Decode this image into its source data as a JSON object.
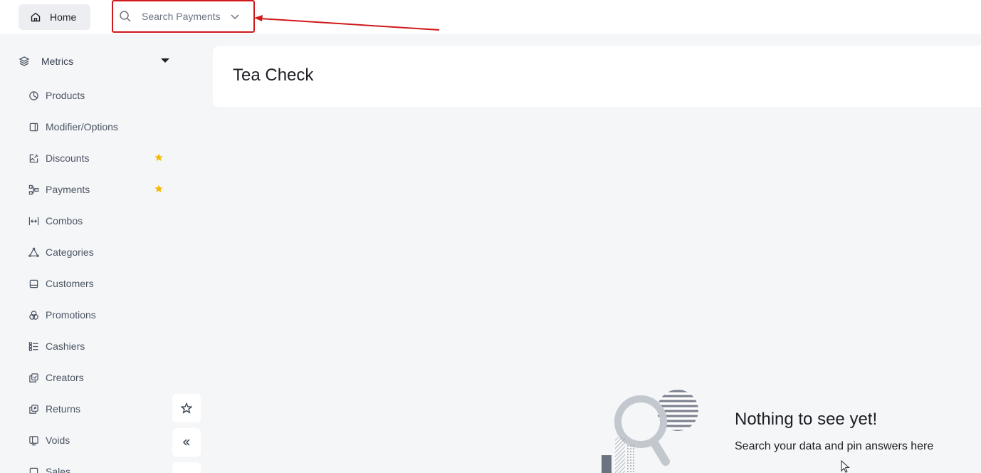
{
  "topbar": {
    "home_label": "Home",
    "search_placeholder": "Search Payments"
  },
  "annotation": {
    "color": "#d0191b"
  },
  "sidebar": {
    "section_label": "Metrics",
    "items": [
      {
        "label": "Products",
        "icon": "pie-chart-icon",
        "starred": false
      },
      {
        "label": "Modifier/Options",
        "icon": "panel-icon",
        "starred": false
      },
      {
        "label": "Discounts",
        "icon": "image-edit-icon",
        "starred": true
      },
      {
        "label": "Payments",
        "icon": "workflow-icon",
        "starred": true
      },
      {
        "label": "Combos",
        "icon": "width-arrows-icon",
        "starred": false
      },
      {
        "label": "Categories",
        "icon": "triangle-nodes-icon",
        "starred": false
      },
      {
        "label": "Customers",
        "icon": "inbox-icon",
        "starred": false
      },
      {
        "label": "Promotions",
        "icon": "circles-icon",
        "starred": false
      },
      {
        "label": "Cashiers",
        "icon": "list-checks-icon",
        "starred": false
      },
      {
        "label": "Creators",
        "icon": "copy-icon",
        "starred": false
      },
      {
        "label": "Returns",
        "icon": "copy-return-icon",
        "starred": false
      },
      {
        "label": "Voids",
        "icon": "monitor-icon",
        "starred": false
      },
      {
        "label": "Sales",
        "icon": "square-icon",
        "starred": false
      }
    ],
    "star_color": "#f5b800"
  },
  "main": {
    "title": "Tea Check",
    "empty_title": "Nothing to see yet!",
    "empty_subtitle": "Search your data and pin answers here"
  }
}
